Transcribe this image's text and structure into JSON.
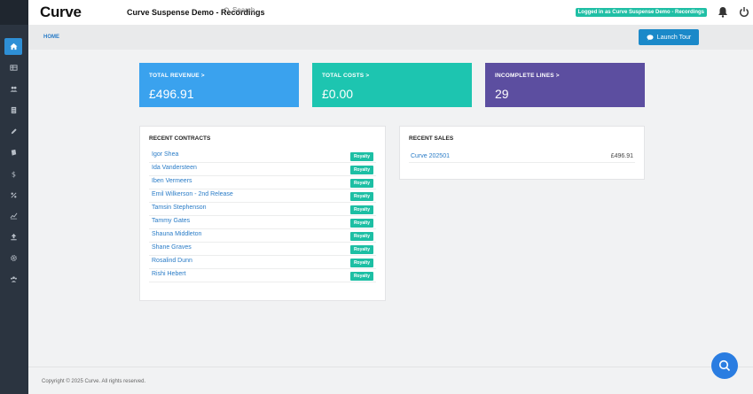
{
  "header": {
    "logo": "Curve",
    "title": "Curve Suspense Demo - Recordings",
    "search_placeholder": "Search",
    "login_badge": "Logged in as Curve Suspense Demo - Recordings"
  },
  "breadcrumb": {
    "home": "HOME"
  },
  "launch_tour": "Launch Tour",
  "sidebar": {
    "items": [
      {
        "icon": "home-icon",
        "active": true
      },
      {
        "icon": "table-icon"
      },
      {
        "icon": "users-icon"
      },
      {
        "icon": "document-icon"
      },
      {
        "icon": "pencil-icon"
      },
      {
        "icon": "book-icon"
      },
      {
        "icon": "dollar-icon"
      },
      {
        "icon": "percent-icon"
      },
      {
        "icon": "chart-icon"
      },
      {
        "icon": "upload-icon"
      },
      {
        "icon": "gear-icon"
      },
      {
        "icon": "group-icon"
      }
    ]
  },
  "stats": {
    "revenue": {
      "label": "TOTAL REVENUE >",
      "value": "£496.91"
    },
    "costs": {
      "label": "TOTAL COSTS >",
      "value": "£0.00"
    },
    "incomplete": {
      "label": "INCOMPLETE LINES >",
      "value": "29"
    }
  },
  "recent_contracts": {
    "title": "RECENT CONTRACTS",
    "rows": [
      {
        "name": "Igor Shea",
        "tag": "Royalty"
      },
      {
        "name": "Ida Vandersteen",
        "tag": "Royalty"
      },
      {
        "name": "Iben Vermeers",
        "tag": "Royalty"
      },
      {
        "name": "Emil Wilkerson - 2nd Release",
        "tag": "Royalty"
      },
      {
        "name": "Tamsin Stephenson",
        "tag": "Royalty"
      },
      {
        "name": "Tammy Gates",
        "tag": "Royalty"
      },
      {
        "name": "Shauna Middleton",
        "tag": "Royalty"
      },
      {
        "name": "Shane Graves",
        "tag": "Royalty"
      },
      {
        "name": "Rosalind Dunn",
        "tag": "Royalty"
      },
      {
        "name": "Rishi Hebert",
        "tag": "Royalty"
      }
    ]
  },
  "recent_sales": {
    "title": "RECENT SALES",
    "rows": [
      {
        "name": "Curve 202501",
        "amount": "£496.91"
      }
    ]
  },
  "footer": "Copyright © 2025 Curve. All rights reserved.",
  "colors": {
    "revenue": "#3aa2ee",
    "costs": "#1dc5b0",
    "incomplete": "#5c4ea0",
    "accent": "#1b89c9",
    "badge": "#1dbfa4"
  }
}
